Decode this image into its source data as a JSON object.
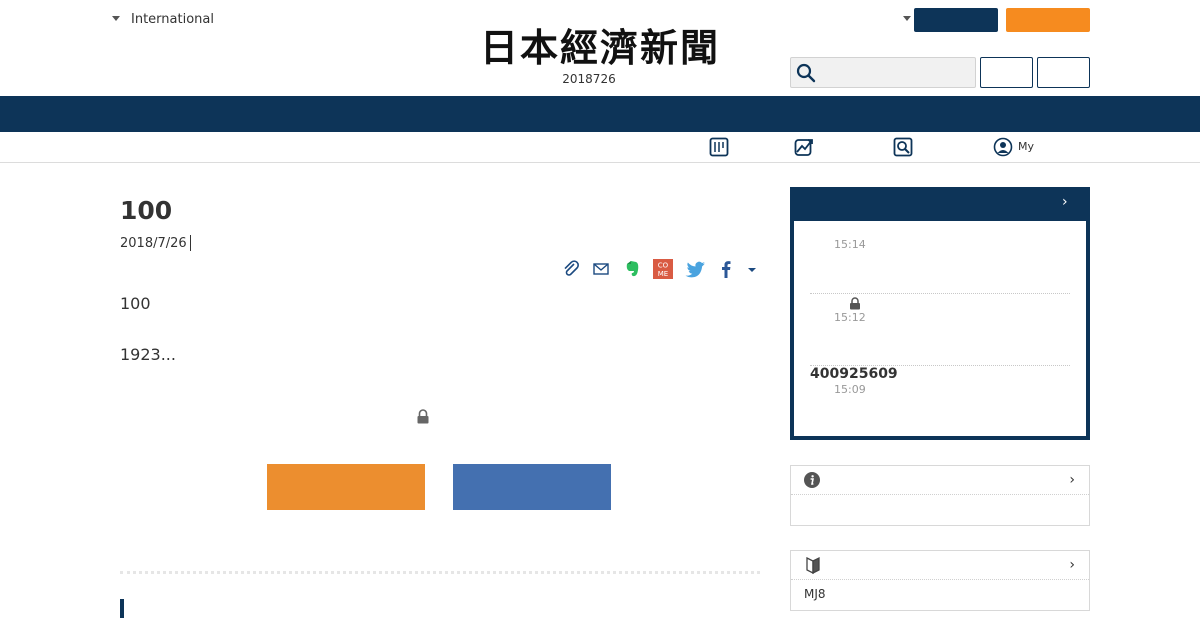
{
  "header": {
    "edition_label": "International",
    "logo_text": "日本經濟新聞",
    "issue_date": "2018726",
    "nav_colors": {
      "brand_navy": "#0d3458",
      "accent_orange": "#f68b1f"
    }
  },
  "subnav": {
    "items": [
      {
        "icon": "paper-edition-icon"
      },
      {
        "icon": "chart-icon"
      },
      {
        "icon": "search-icon"
      },
      {
        "icon": "user-icon",
        "label": "My"
      }
    ]
  },
  "article": {
    "title": "100",
    "date": "2018/7/26",
    "paragraphs": [
      "100",
      "1923..."
    ],
    "share_icons": [
      "clip-icon",
      "mail-icon",
      "evernote-icon",
      "come-icon",
      "twitter-icon",
      "facebook-icon",
      "more-caret-icon"
    ],
    "come_text": "CO\nME",
    "cta_colors": {
      "primary": "#ec8e2f",
      "secondary": "#4470b0"
    }
  },
  "ranking": {
    "items": [
      {
        "time": "15:14",
        "title": "",
        "locked": false
      },
      {
        "time": "15:12",
        "title": "",
        "locked": true
      },
      {
        "time": "15:09",
        "title": "400925609",
        "locked": false
      }
    ]
  },
  "sidebar": {
    "info_box": {
      "icon": "info-icon"
    },
    "beginner_box": {
      "icon": "beginner-mark-icon",
      "item": "MJ8"
    }
  }
}
